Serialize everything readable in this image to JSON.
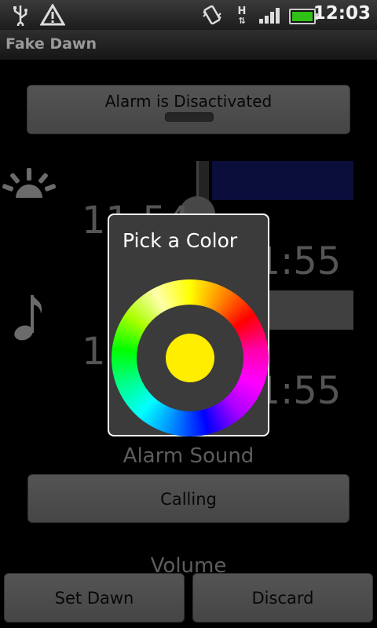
{
  "status_bar": {
    "time": "12:03",
    "network_letter": "H",
    "icons": [
      "usb-icon",
      "warning-icon",
      "vibrate-icon",
      "signal-icon",
      "battery-icon"
    ]
  },
  "app": {
    "title": "Fake Dawn"
  },
  "alarm": {
    "toggle_label": "Alarm is Disactivated"
  },
  "dawn": {
    "light_start_time": "11:54",
    "light_end_time": "11:55",
    "light_color": "#1b1f8c"
  },
  "sound": {
    "start_time": "11:54",
    "end_time": "11:55",
    "section_label": "Alarm Sound",
    "sound_value": "Calling",
    "volume_label": "Volume"
  },
  "buttons": {
    "set_dawn": "Set Dawn",
    "discard": "Discard"
  },
  "dialog": {
    "title": "Pick a Color",
    "selected_color": "#ffee00"
  }
}
